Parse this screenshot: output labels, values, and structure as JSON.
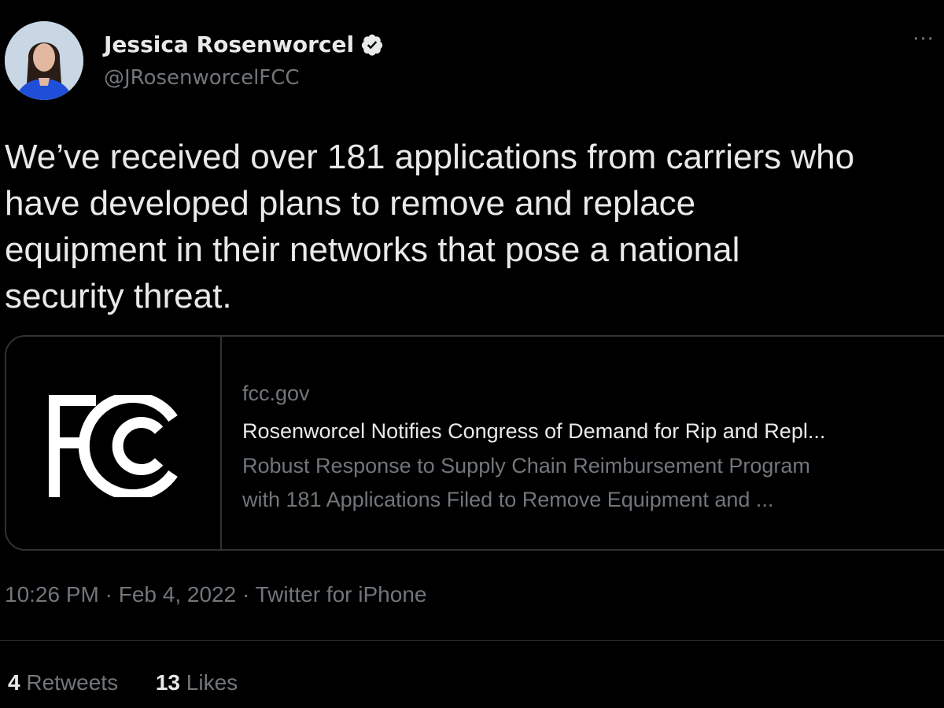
{
  "author": {
    "name": "Jessica Rosenworcel",
    "handle": "@JRosenworcelFCC",
    "verified_icon": "verified-badge-icon",
    "avatar": "profile-photo"
  },
  "menu_icon": "more-options-icon",
  "tweet": {
    "text_lines": [
      "We’ve received over 181 applications from carriers who",
      "have developed plans to remove and replace",
      "equipment in their networks that pose a national",
      "security threat."
    ]
  },
  "card": {
    "logo": "FCC",
    "domain": "fcc.gov",
    "title": "Rosenworcel Notifies Congress of Demand for Rip and Repl...",
    "description_lines": [
      "Robust Response to Supply Chain Reimbursement Program",
      "with 181 Applications Filed to Remove Equipment and ..."
    ]
  },
  "meta": {
    "time": "10:26 PM",
    "separator": " · ",
    "date": "Feb 4, 2022",
    "source": "Twitter for iPhone"
  },
  "stats": {
    "retweets_count": "4",
    "retweets_label": "Retweets",
    "likes_count": "13",
    "likes_label": "Likes"
  },
  "colors": {
    "background": "#000000",
    "primary_text": "#e7e9ea",
    "secondary_text": "#71767b",
    "border": "#2f3336"
  }
}
